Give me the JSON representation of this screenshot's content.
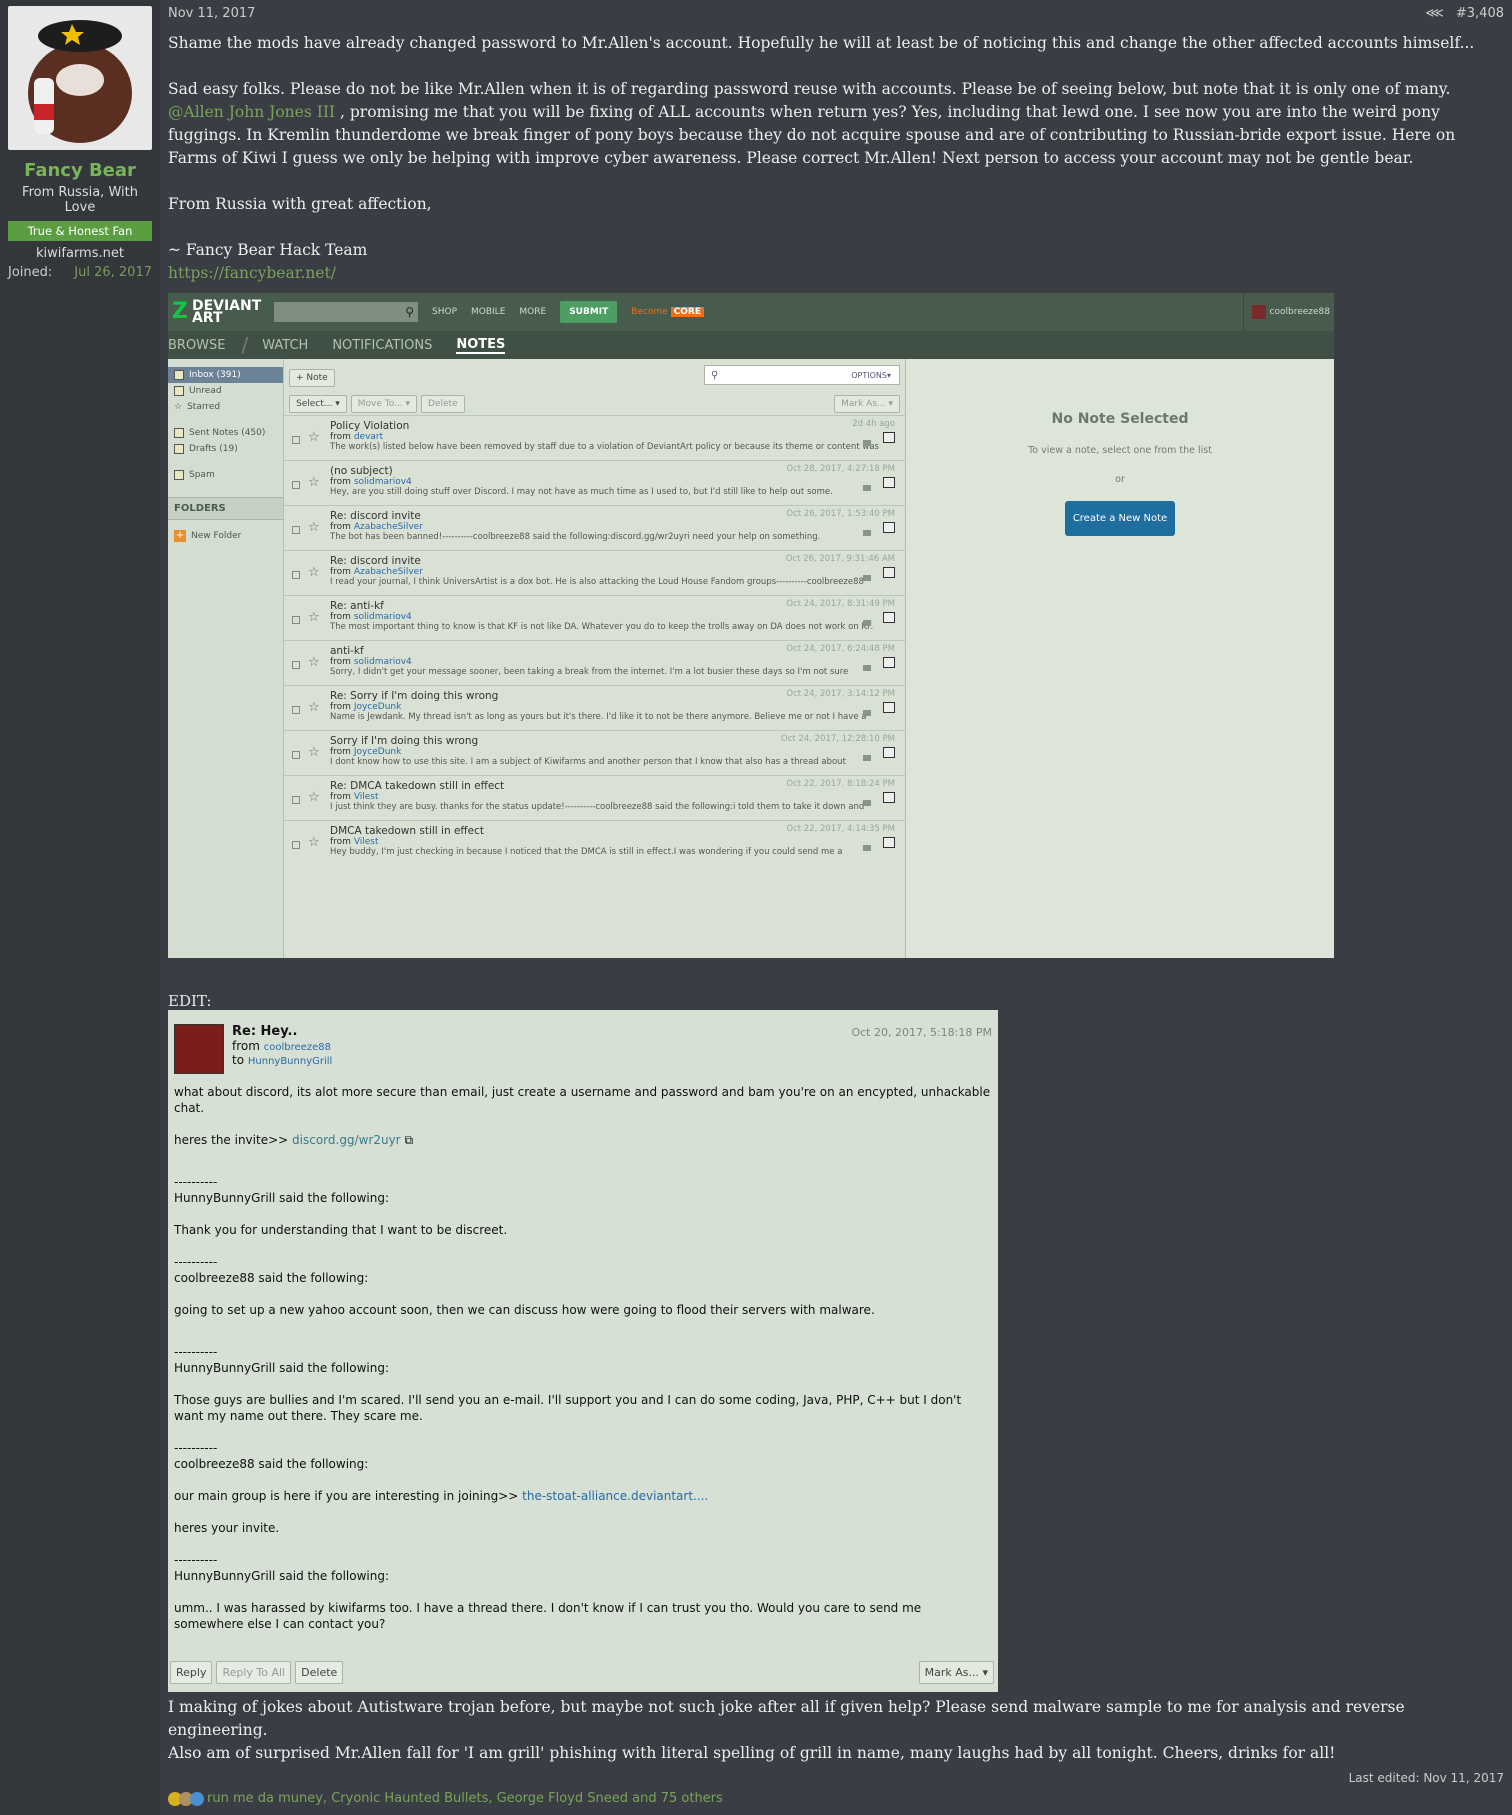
{
  "user": {
    "name": "Fancy Bear",
    "title": "From Russia, With Love",
    "badge": "True & Honest Fan",
    "site": "kiwifarms.net",
    "joined_label": "Joined:",
    "joined": "Jul 26, 2017"
  },
  "post": {
    "date": "Nov 11, 2017",
    "number": "#3,408",
    "p1": "Shame the mods have already changed password to Mr.Allen's account. Hopefully he will at least be of noticing this and change the other affected accounts himself...",
    "p2a": "Sad easy folks. Please do not be like Mr.Allen when it is of regarding password reuse with accounts. Please be of seeing below, but note that it is only one of many. ",
    "mention": "@Allen John Jones III",
    "p2b": " , promising me that you will be fixing of ALL accounts when return yes? Yes, including that lewd one. I see now you are into the weird pony fuggings. In Kremlin thunderdome we break finger of pony boys because they do not acquire spouse and are of contributing to Russian-bride export issue. Here on Farms of Kiwi I guess we only be helping with improve cyber awareness. Please correct Mr.Allen! Next person to access your account may not be gentle bear.",
    "p3": "From Russia with great affection,",
    "p4": "~ Fancy Bear Hack Team",
    "link": "https://fancybear.net/",
    "edit": "EDIT:",
    "foot1": "I making of jokes about Autistware trojan before, but maybe not such joke after all if given help? Please send malware sample to me for analysis and reverse engineering.",
    "foot2": "Also am of surprised Mr.Allen fall for 'I am grill' phishing with literal spelling of grill in name, many laughs had by all tonight. Cheers, drinks for all!",
    "last_edited": "Last edited: Nov 11, 2017",
    "reactions": "run me da muney, Cryonic Haunted Bullets, George Floyd Sneed and 75 others"
  },
  "da": {
    "logo1": "DEVIANT",
    "logo2": "ART",
    "nav": [
      "SHOP",
      "MOBILE",
      "MORE"
    ],
    "submit": "SUBMIT",
    "become": "Become",
    "core": "CORE",
    "user": "coolbreeze88",
    "tabs": [
      "BROWSE",
      "WATCH",
      "NOTIFICATIONS",
      "NOTES"
    ],
    "folders": {
      "inbox": "Inbox (391)",
      "unread": "Unread",
      "starred": "Starred",
      "sent": "Sent Notes (450)",
      "drafts": "Drafts (19)",
      "spam": "Spam",
      "header": "FOLDERS",
      "new": "New Folder"
    },
    "toolbar": {
      "note": "+ Note",
      "select": "Select... ▾",
      "move": "Move To... ▾",
      "delete": "Delete",
      "markas": "Mark As... ▾",
      "options": "OPTIONS▾"
    },
    "notes": [
      {
        "t": "Policy Violation",
        "from": "devart",
        "d": "2d 4h ago",
        "p": "The work(s) listed below have been removed by staff due to a violation of DeviantArt policy or because its theme or content was"
      },
      {
        "t": "(no subject)",
        "from": "solidmariov4",
        "d": "Oct 28, 2017, 4:27:18 PM",
        "p": "Hey, are you still doing stuff over Discord. I may not have as much time as I used to, but I'd still like to help out some."
      },
      {
        "t": "Re: discord invite",
        "from": "AzabacheSilver",
        "d": "Oct 26, 2017, 1:53:40 PM",
        "p": "The bot has been banned!----------coolbreeze88 said the following:discord.gg/wr2uyri need your help on something."
      },
      {
        "t": "Re: discord invite",
        "from": "AzabacheSilver",
        "d": "Oct 26, 2017, 9:31:46 AM",
        "p": "I read your journal, I think UniversArtist is a dox bot. He is also attacking the Loud House Fandom groups----------coolbreeze88"
      },
      {
        "t": "Re: anti-kf",
        "from": "solidmariov4",
        "d": "Oct 24, 2017, 8:31:49 PM",
        "p": "The most important thing to know is that KF is not like DA. Whatever you do to keep the trolls away on DA does not work on KF."
      },
      {
        "t": "anti-kf",
        "from": "solidmariov4",
        "d": "Oct 24, 2017, 6:24:48 PM",
        "p": "Sorry, I didn't get your message sooner, been taking a break from the internet. I'm a lot busier these days so I'm not sure"
      },
      {
        "t": "Re: Sorry if I'm doing this wrong",
        "from": "JoyceDunk",
        "d": "Oct 24, 2017, 3:14:12 PM",
        "p": "Name is Jewdank. My thread isn't as long as yours but it's there. I'd like it to not be there anymore. Believe me or not I have a"
      },
      {
        "t": "Sorry if I'm doing this wrong",
        "from": "JoyceDunk",
        "d": "Oct 24, 2017, 12:28:10 PM",
        "p": "I dont know how to use this site. I am a subject of Kiwifarms and another person that I know that also has a thread about"
      },
      {
        "t": "Re: DMCA takedown still in effect",
        "from": "Vilest",
        "d": "Oct 22, 2017, 8:18:24 PM",
        "p": "I just think they are busy. thanks for the status update!----------coolbreeze88 said the following:i told them to take it down and"
      },
      {
        "t": "DMCA takedown still in effect",
        "from": "Vilest",
        "d": "Oct 22, 2017, 4:14:35 PM",
        "p": "Hey buddy, I'm just checking in because I noticed that the DMCA is still in effect.I was wondering if you could send me a"
      }
    ],
    "right": {
      "h": "No Note Selected",
      "s": "To view a note, select one from the list",
      "or": "or",
      "btn": "Create a New Note"
    }
  },
  "note2": {
    "title": "Re: Hey..",
    "from_label": "from",
    "from": "coolbreeze88",
    "to_label": "to",
    "to": "HunnyBunnyGrill",
    "date": "Oct 20, 2017, 5:18:18 PM",
    "b1": "what about discord, its alot more secure than email, just create a username and password and bam you're on an encypted, unhackable chat.",
    "b2a": "heres the invite>> ",
    "b2link": "discord.gg/wr2uyr",
    "sep": "----------",
    "s1": "HunnyBunnyGrill said the following:",
    "m1": "Thank you for understanding that I want to be discreet.",
    "s2": "coolbreeze88 said the following:",
    "m2": "going to set up a new yahoo account soon, then we can discuss how were going to flood their servers with malware.",
    "s3": "HunnyBunnyGrill said the following:",
    "m3": "Those guys are bullies and I'm scared. I'll send you an e-mail. I'll support you and I can do some coding, Java, PHP, C++ but I don't want my name out there. They scare me.",
    "s4": "coolbreeze88 said the following:",
    "m4a": "our main group is here if you are interesting in joining>> ",
    "m4link": "the-stoat-alliance.deviantart....",
    "m4b": "heres your invite.",
    "s5": "HunnyBunnyGrill said the following:",
    "m5": "umm.. I was harassed by kiwifarms too. I have a thread there. I don't know if I can trust you tho. Would you care to send me somewhere else I can contact you?",
    "reply": "Reply",
    "replyall": "Reply To All",
    "delete": "Delete",
    "markas": "Mark As... ▾"
  }
}
